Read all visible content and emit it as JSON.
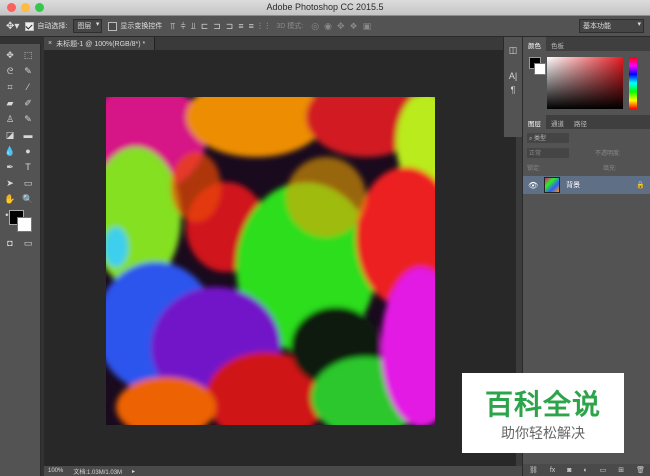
{
  "window": {
    "title": "Adobe Photoshop CC 2015.5"
  },
  "options_bar": {
    "auto_select_label": "自动选择:",
    "auto_select_value": "图层",
    "show_transform_label": "显示变换控件",
    "mode_3d_label": "3D 模式:",
    "workspace": "基本功能"
  },
  "document": {
    "tab_label": "未标题-1 @ 100%(RGB/8*) *"
  },
  "status": {
    "zoom": "100%",
    "doc_size": "文档:1.03M/1.03M"
  },
  "panels": {
    "color_tabs": [
      "颜色",
      "色板"
    ],
    "layers_tabs": [
      "图层",
      "通道",
      "路径"
    ],
    "kind_filter": "类型",
    "blend_mode": "正常",
    "opacity_label": "不透明度:",
    "lock_label": "锁定:",
    "fill_label": "填充:",
    "layer_name": "背景"
  },
  "watermark": {
    "title": "百科全说",
    "subtitle": "助你轻松解决"
  },
  "colors": {
    "foreground": "#000000",
    "background": "#ffffff"
  }
}
